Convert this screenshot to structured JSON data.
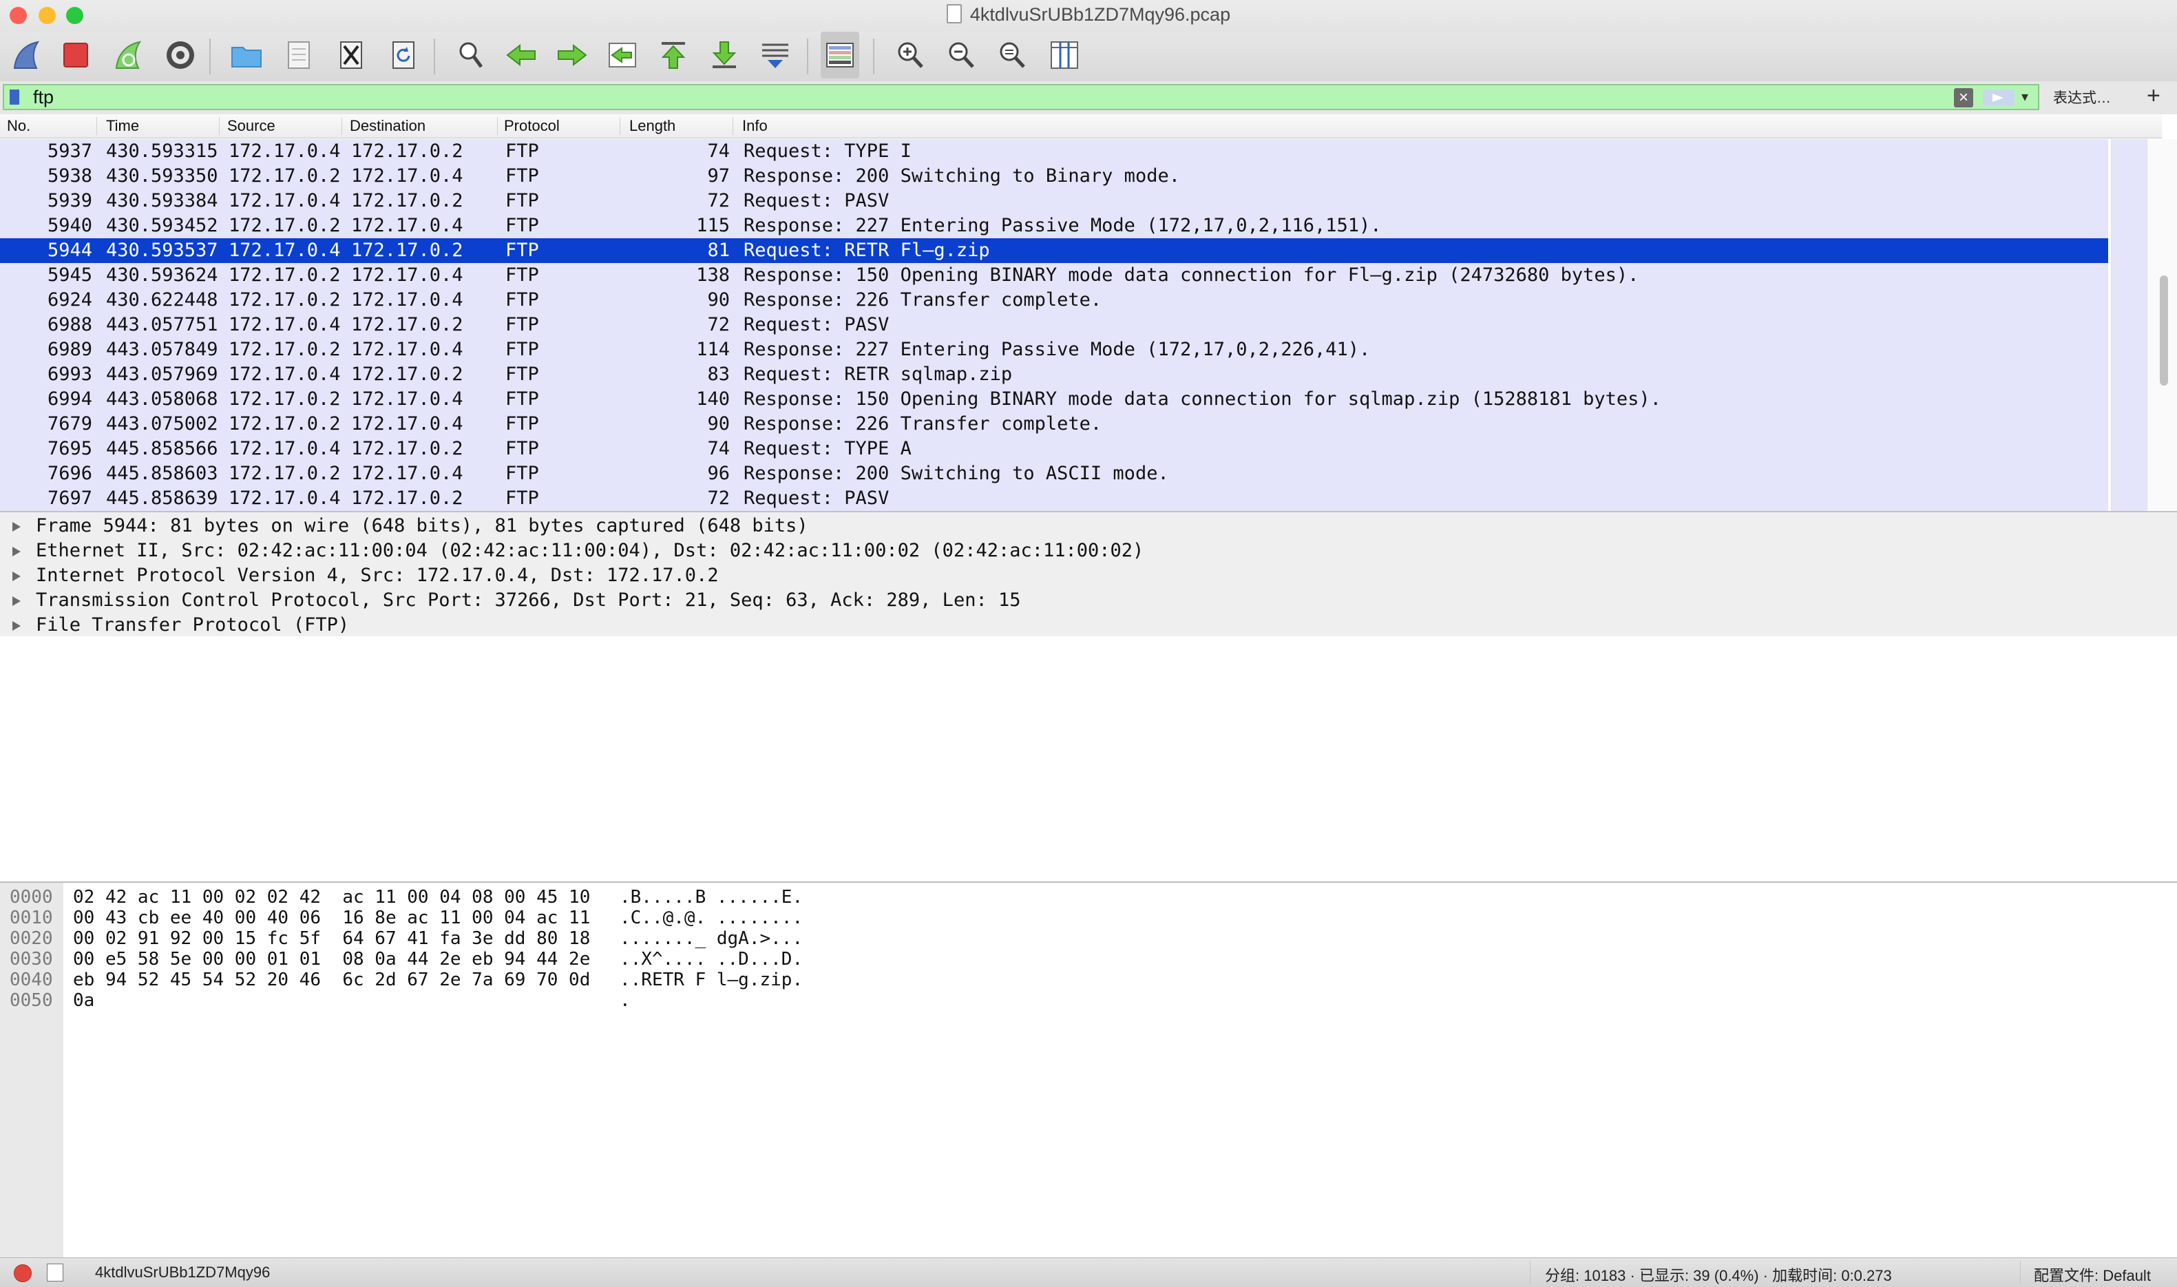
{
  "window": {
    "title": "4ktdlvuSrUBb1ZD7Mqy96.pcap",
    "traffic_lights": {
      "close_color": "#fd5f57",
      "minimize_color": "#febc2e",
      "zoom_color": "#28c840"
    }
  },
  "toolbar": {
    "buttons": [
      {
        "name": "start-capture-icon"
      },
      {
        "name": "stop-capture-icon"
      },
      {
        "name": "restart-capture-icon"
      },
      {
        "name": "capture-options-icon"
      },
      {
        "name": "open-file-icon"
      },
      {
        "name": "save-file-icon"
      },
      {
        "name": "close-file-icon"
      },
      {
        "name": "reload-file-icon"
      },
      {
        "name": "find-packet-icon"
      },
      {
        "name": "go-back-icon"
      },
      {
        "name": "go-forward-icon"
      },
      {
        "name": "go-to-packet-icon"
      },
      {
        "name": "go-first-packet-icon"
      },
      {
        "name": "go-last-packet-icon"
      },
      {
        "name": "auto-scroll-icon"
      },
      {
        "name": "colorize-icon"
      },
      {
        "name": "zoom-in-icon"
      },
      {
        "name": "zoom-out-icon"
      },
      {
        "name": "normal-size-icon"
      },
      {
        "name": "resize-columns-icon"
      }
    ]
  },
  "filter": {
    "value": "ftp",
    "background": "#b4f5b4",
    "expression_label": "表达式…",
    "add_label": "+"
  },
  "packet_list": {
    "columns": [
      "No.",
      "Time",
      "Source",
      "Destination",
      "Protocol",
      "Length",
      "Info"
    ],
    "selected_index": 4,
    "row_color": "#e4e5fa",
    "selected_color": "#0b3fd0",
    "rows": [
      {
        "no": "5937",
        "time": "430.593315",
        "src": "172.17.0.4",
        "dst": "172.17.0.2",
        "proto": "FTP",
        "len": "74",
        "info": "Request: TYPE I"
      },
      {
        "no": "5938",
        "time": "430.593350",
        "src": "172.17.0.2",
        "dst": "172.17.0.4",
        "proto": "FTP",
        "len": "97",
        "info": "Response: 200 Switching to Binary mode."
      },
      {
        "no": "5939",
        "time": "430.593384",
        "src": "172.17.0.4",
        "dst": "172.17.0.2",
        "proto": "FTP",
        "len": "72",
        "info": "Request: PASV"
      },
      {
        "no": "5940",
        "time": "430.593452",
        "src": "172.17.0.2",
        "dst": "172.17.0.4",
        "proto": "FTP",
        "len": "115",
        "info": "Response: 227 Entering Passive Mode (172,17,0,2,116,151)."
      },
      {
        "no": "5944",
        "time": "430.593537",
        "src": "172.17.0.4",
        "dst": "172.17.0.2",
        "proto": "FTP",
        "len": "81",
        "info": "Request: RETR Fl–g.zip"
      },
      {
        "no": "5945",
        "time": "430.593624",
        "src": "172.17.0.2",
        "dst": "172.17.0.4",
        "proto": "FTP",
        "len": "138",
        "info": "Response: 150 Opening BINARY mode data connection for Fl–g.zip (24732680 bytes)."
      },
      {
        "no": "6924",
        "time": "430.622448",
        "src": "172.17.0.2",
        "dst": "172.17.0.4",
        "proto": "FTP",
        "len": "90",
        "info": "Response: 226 Transfer complete."
      },
      {
        "no": "6988",
        "time": "443.057751",
        "src": "172.17.0.4",
        "dst": "172.17.0.2",
        "proto": "FTP",
        "len": "72",
        "info": "Request: PASV"
      },
      {
        "no": "6989",
        "time": "443.057849",
        "src": "172.17.0.2",
        "dst": "172.17.0.4",
        "proto": "FTP",
        "len": "114",
        "info": "Response: 227 Entering Passive Mode (172,17,0,2,226,41)."
      },
      {
        "no": "6993",
        "time": "443.057969",
        "src": "172.17.0.4",
        "dst": "172.17.0.2",
        "proto": "FTP",
        "len": "83",
        "info": "Request: RETR sqlmap.zip"
      },
      {
        "no": "6994",
        "time": "443.058068",
        "src": "172.17.0.2",
        "dst": "172.17.0.4",
        "proto": "FTP",
        "len": "140",
        "info": "Response: 150 Opening BINARY mode data connection for sqlmap.zip (15288181 bytes)."
      },
      {
        "no": "7679",
        "time": "443.075002",
        "src": "172.17.0.2",
        "dst": "172.17.0.4",
        "proto": "FTP",
        "len": "90",
        "info": "Response: 226 Transfer complete."
      },
      {
        "no": "7695",
        "time": "445.858566",
        "src": "172.17.0.4",
        "dst": "172.17.0.2",
        "proto": "FTP",
        "len": "74",
        "info": "Request: TYPE A"
      },
      {
        "no": "7696",
        "time": "445.858603",
        "src": "172.17.0.2",
        "dst": "172.17.0.4",
        "proto": "FTP",
        "len": "96",
        "info": "Response: 200 Switching to ASCII mode."
      },
      {
        "no": "7697",
        "time": "445.858639",
        "src": "172.17.0.4",
        "dst": "172.17.0.2",
        "proto": "FTP",
        "len": "72",
        "info": "Request: PASV"
      }
    ]
  },
  "details": [
    "Frame 5944: 81 bytes on wire (648 bits), 81 bytes captured (648 bits)",
    "Ethernet II, Src: 02:42:ac:11:00:04 (02:42:ac:11:00:04), Dst: 02:42:ac:11:00:02 (02:42:ac:11:00:02)",
    "Internet Protocol Version 4, Src: 172.17.0.4, Dst: 172.17.0.2",
    "Transmission Control Protocol, Src Port: 37266, Dst Port: 21, Seq: 63, Ack: 289, Len: 15",
    "File Transfer Protocol (FTP)"
  ],
  "hex_dump": [
    {
      "offset": "0000",
      "bytes": "02 42 ac 11 00 02 02 42  ac 11 00 04 08 00 45 10",
      "ascii": ".B.....B ......E."
    },
    {
      "offset": "0010",
      "bytes": "00 43 cb ee 40 00 40 06  16 8e ac 11 00 04 ac 11",
      "ascii": ".C..@.@. ........"
    },
    {
      "offset": "0020",
      "bytes": "00 02 91 92 00 15 fc 5f  64 67 41 fa 3e dd 80 18",
      "ascii": "......._ dgA.>..."
    },
    {
      "offset": "0030",
      "bytes": "00 e5 58 5e 00 00 01 01  08 0a 44 2e eb 94 44 2e",
      "ascii": "..X^.... ..D...D."
    },
    {
      "offset": "0040",
      "bytes": "eb 94 52 45 54 52 20 46  6c 2d 67 2e 7a 69 70 0d",
      "ascii": "..RETR F l–g.zip."
    },
    {
      "offset": "0050",
      "bytes": "0a",
      "ascii": "."
    }
  ],
  "status": {
    "file": "4ktdlvuSrUBb1ZD7Mqy96",
    "counts": "分组: 10183 · 已显示: 39 (0.4%) · 加载时间: 0:0.273",
    "profile": "配置文件: Default"
  }
}
